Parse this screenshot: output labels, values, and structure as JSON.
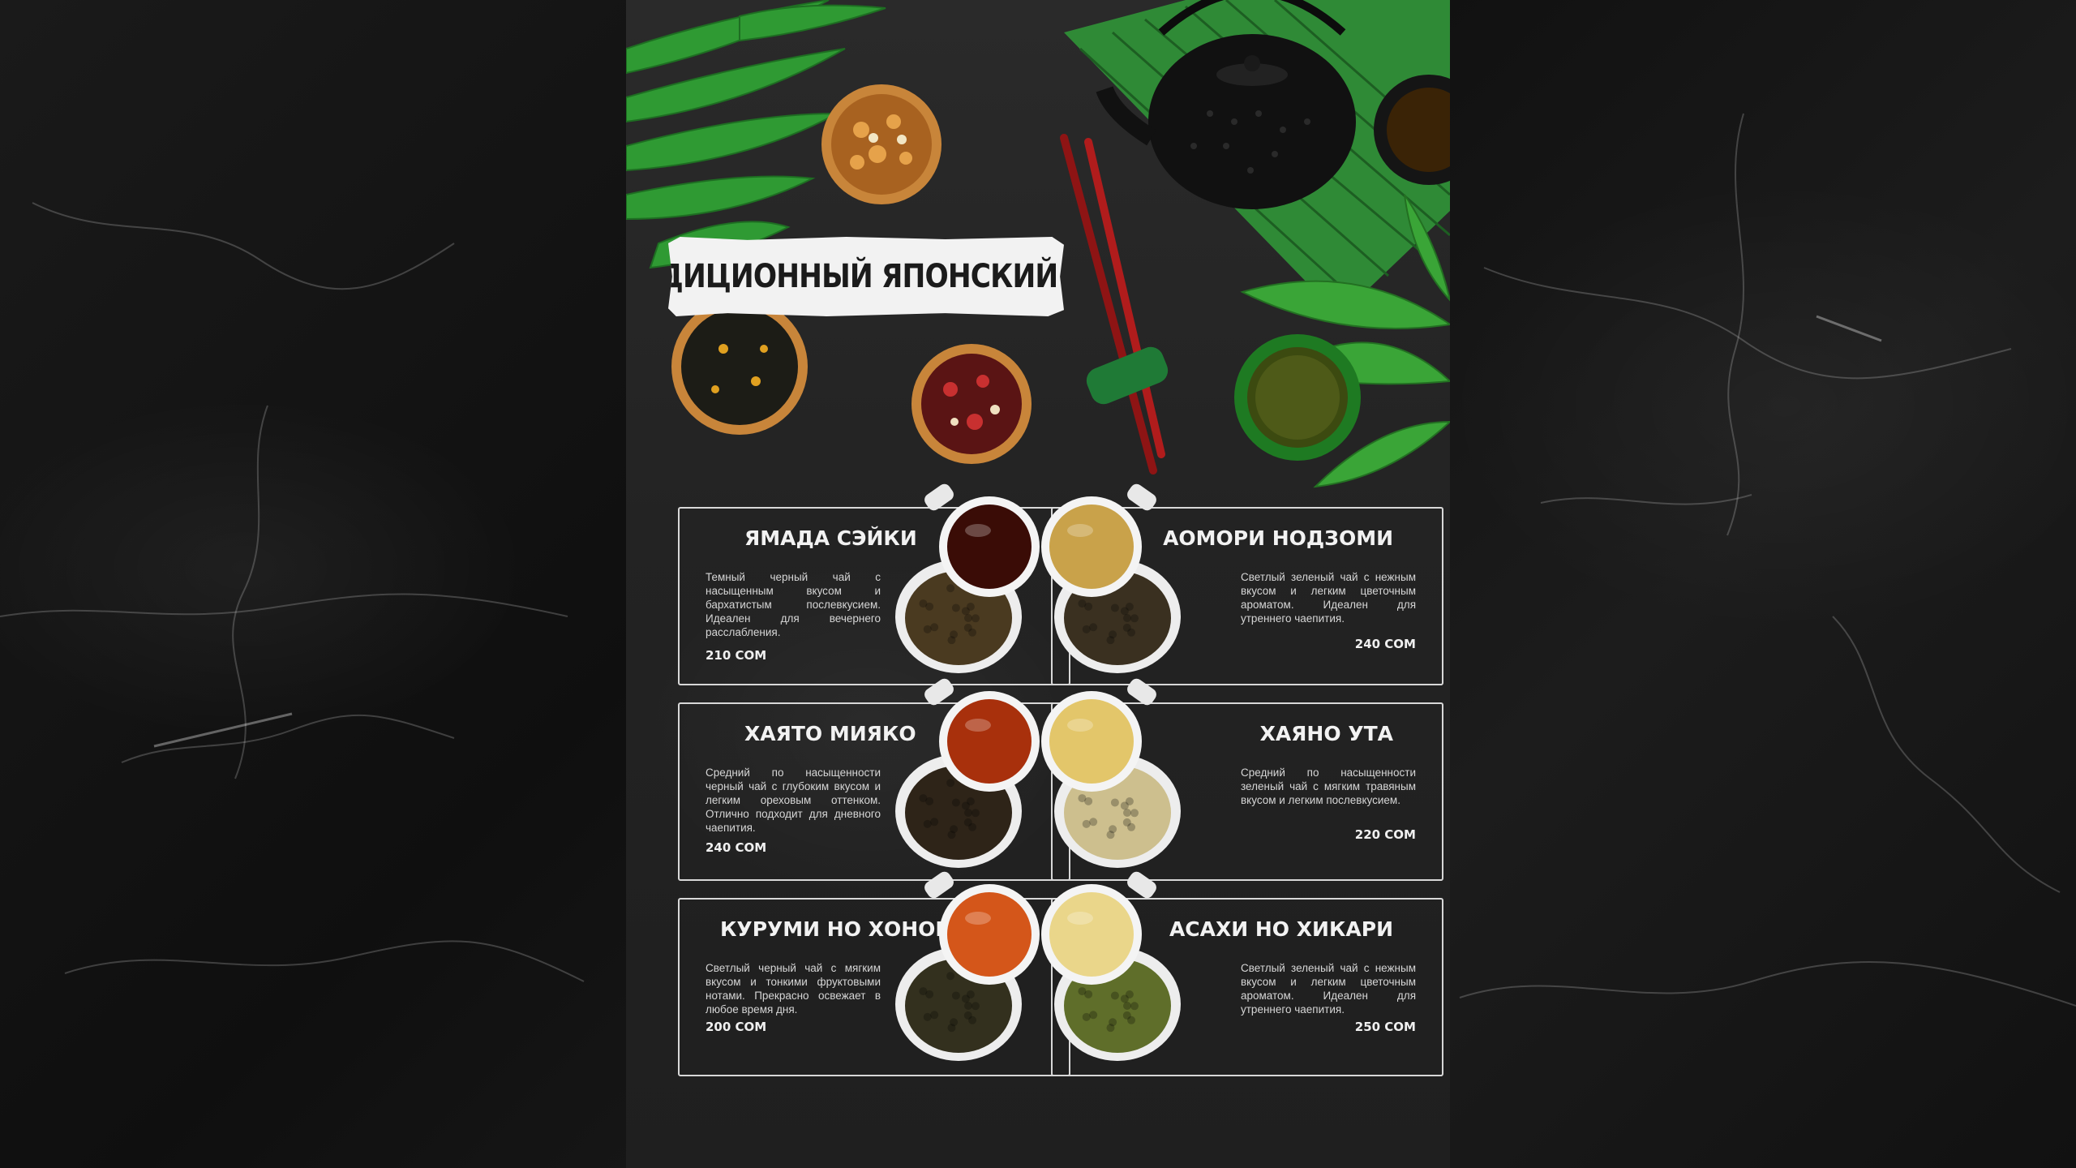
{
  "title": "ТРАДИЦИОННЫЙ ЯПОНСКИЙ ЧАЙ",
  "teas": [
    {
      "name": "ЯМАДА СЭЙКИ",
      "description": "Темный черный чай с насыщенным вкусом и бархатистым послевкусием. Идеален для вечернего расслабления.",
      "price": "210 СОМ",
      "tea_color": "#3a0c06",
      "leaf_color": "#4a3a20"
    },
    {
      "name": "АОМОРИ НОДЗОМИ",
      "description": "Светлый зеленый чай с нежным вкусом и легким цветочным ароматом. Идеален для утреннего чаепития.",
      "price": "240 СОМ",
      "tea_color": "#c9a24a",
      "leaf_color": "#3a3020"
    },
    {
      "name": "ХАЯТО МИЯКО",
      "description": "Средний по насыщенности черный чай с глубоким вкусом и легким ореховым оттенком. Отлично подходит для дневного чаепития.",
      "price": "240 СОМ",
      "tea_color": "#a8300c",
      "leaf_color": "#2e2418"
    },
    {
      "name": "ХАЯНО УТА",
      "description": "Средний по насыщенности зеленый чай с мягким травяным вкусом и легким послевкусием.",
      "price": "220 СОМ",
      "tea_color": "#e3c66a",
      "leaf_color": "#cdbf8e"
    },
    {
      "name": "КУРУМИ НО ХОНОКА",
      "description": "Светлый черный чай с мягким вкусом и тонкими фруктовыми нотами. Прекрасно освежает в любое время дня.",
      "price": "200 СОМ",
      "tea_color": "#d4561a",
      "leaf_color": "#33301e"
    },
    {
      "name": "АСАХИ НО ХИКАРИ",
      "description": "Светлый зеленый чай с нежным вкусом и легким цветочным ароматом. Идеален для утреннего чаепития.",
      "price": "250 СОМ",
      "tea_color": "#ead68a",
      "leaf_color": "#5f6e2a"
    }
  ]
}
